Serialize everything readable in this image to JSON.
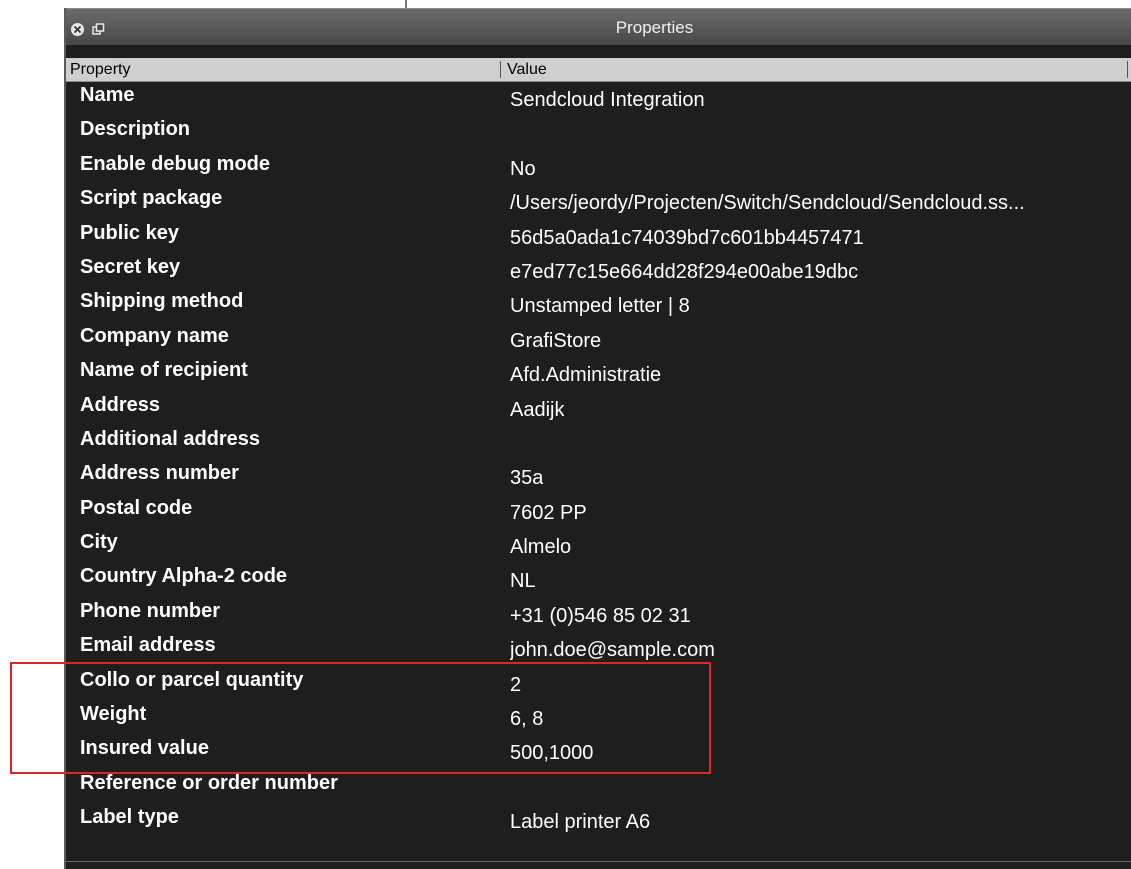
{
  "window": {
    "title": "Properties",
    "close_icon": "close-icon",
    "float_icon": "float-window-icon"
  },
  "table": {
    "headers": {
      "property": "Property",
      "value": "Value"
    },
    "rows": [
      {
        "property": "Name",
        "value": "Sendcloud Integration"
      },
      {
        "property": "Description",
        "value": ""
      },
      {
        "property": "Enable debug mode",
        "value": "No"
      },
      {
        "property": "Script package",
        "value": "/Users/jeordy/Projecten/Switch/Sendcloud/Sendcloud.ss..."
      },
      {
        "property": "Public key",
        "value": "56d5a0ada1c74039bd7c601bb4457471"
      },
      {
        "property": "Secret key",
        "value": "e7ed77c15e664dd28f294e00abe19dbc"
      },
      {
        "property": "Shipping method",
        "value": "Unstamped letter | 8"
      },
      {
        "property": "Company name",
        "value": "GrafiStore"
      },
      {
        "property": "Name of recipient",
        "value": "Afd.Administratie"
      },
      {
        "property": "Address",
        "value": "Aadijk"
      },
      {
        "property": "Additional address",
        "value": ""
      },
      {
        "property": "Address number",
        "value": "35a"
      },
      {
        "property": "Postal code",
        "value": "7602 PP"
      },
      {
        "property": "City",
        "value": "Almelo"
      },
      {
        "property": "Country Alpha-2 code",
        "value": "NL"
      },
      {
        "property": "Phone number",
        "value": "+31 (0)546 85 02 31"
      },
      {
        "property": "Email address",
        "value": "john.doe@sample.com"
      },
      {
        "property": "Collo or parcel quantity",
        "value": "2"
      },
      {
        "property": "Weight",
        "value": "6, 8"
      },
      {
        "property": "Insured value",
        "value": "500,1000"
      },
      {
        "property": "Reference or order number",
        "value": ""
      },
      {
        "property": "Label type",
        "value": "Label printer A6"
      }
    ]
  },
  "colors": {
    "panel_bg": "#1e1e1e",
    "header_bg": "#cfcfcf",
    "highlight": "#d8262b",
    "text": "#ffffff"
  }
}
